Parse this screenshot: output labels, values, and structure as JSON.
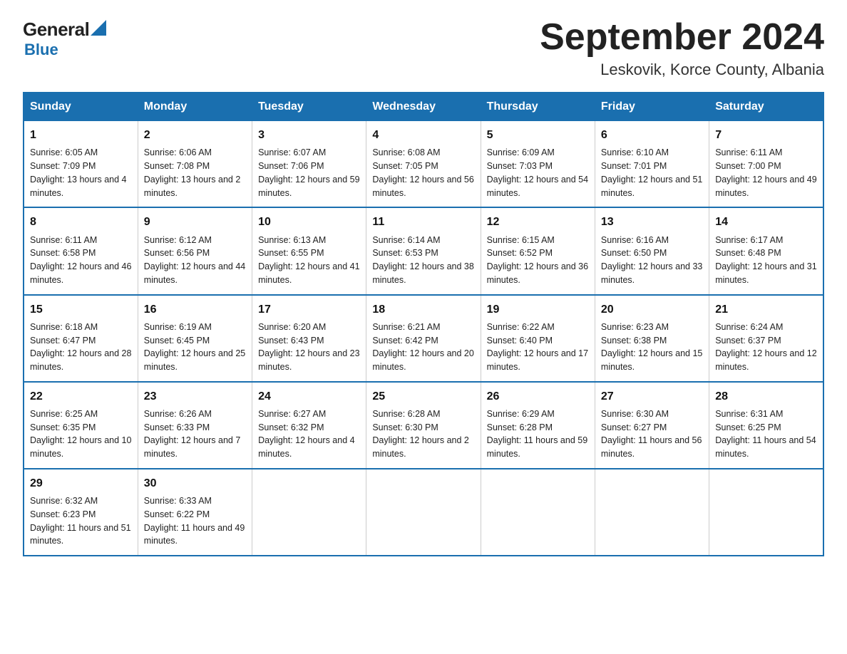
{
  "header": {
    "logo_general": "General",
    "logo_blue": "Blue",
    "title": "September 2024",
    "location": "Leskovik, Korce County, Albania"
  },
  "days_of_week": [
    "Sunday",
    "Monday",
    "Tuesday",
    "Wednesday",
    "Thursday",
    "Friday",
    "Saturday"
  ],
  "weeks": [
    [
      {
        "num": "1",
        "sunrise": "6:05 AM",
        "sunset": "7:09 PM",
        "daylight": "13 hours and 4 minutes."
      },
      {
        "num": "2",
        "sunrise": "6:06 AM",
        "sunset": "7:08 PM",
        "daylight": "13 hours and 2 minutes."
      },
      {
        "num": "3",
        "sunrise": "6:07 AM",
        "sunset": "7:06 PM",
        "daylight": "12 hours and 59 minutes."
      },
      {
        "num": "4",
        "sunrise": "6:08 AM",
        "sunset": "7:05 PM",
        "daylight": "12 hours and 56 minutes."
      },
      {
        "num": "5",
        "sunrise": "6:09 AM",
        "sunset": "7:03 PM",
        "daylight": "12 hours and 54 minutes."
      },
      {
        "num": "6",
        "sunrise": "6:10 AM",
        "sunset": "7:01 PM",
        "daylight": "12 hours and 51 minutes."
      },
      {
        "num": "7",
        "sunrise": "6:11 AM",
        "sunset": "7:00 PM",
        "daylight": "12 hours and 49 minutes."
      }
    ],
    [
      {
        "num": "8",
        "sunrise": "6:11 AM",
        "sunset": "6:58 PM",
        "daylight": "12 hours and 46 minutes."
      },
      {
        "num": "9",
        "sunrise": "6:12 AM",
        "sunset": "6:56 PM",
        "daylight": "12 hours and 44 minutes."
      },
      {
        "num": "10",
        "sunrise": "6:13 AM",
        "sunset": "6:55 PM",
        "daylight": "12 hours and 41 minutes."
      },
      {
        "num": "11",
        "sunrise": "6:14 AM",
        "sunset": "6:53 PM",
        "daylight": "12 hours and 38 minutes."
      },
      {
        "num": "12",
        "sunrise": "6:15 AM",
        "sunset": "6:52 PM",
        "daylight": "12 hours and 36 minutes."
      },
      {
        "num": "13",
        "sunrise": "6:16 AM",
        "sunset": "6:50 PM",
        "daylight": "12 hours and 33 minutes."
      },
      {
        "num": "14",
        "sunrise": "6:17 AM",
        "sunset": "6:48 PM",
        "daylight": "12 hours and 31 minutes."
      }
    ],
    [
      {
        "num": "15",
        "sunrise": "6:18 AM",
        "sunset": "6:47 PM",
        "daylight": "12 hours and 28 minutes."
      },
      {
        "num": "16",
        "sunrise": "6:19 AM",
        "sunset": "6:45 PM",
        "daylight": "12 hours and 25 minutes."
      },
      {
        "num": "17",
        "sunrise": "6:20 AM",
        "sunset": "6:43 PM",
        "daylight": "12 hours and 23 minutes."
      },
      {
        "num": "18",
        "sunrise": "6:21 AM",
        "sunset": "6:42 PM",
        "daylight": "12 hours and 20 minutes."
      },
      {
        "num": "19",
        "sunrise": "6:22 AM",
        "sunset": "6:40 PM",
        "daylight": "12 hours and 17 minutes."
      },
      {
        "num": "20",
        "sunrise": "6:23 AM",
        "sunset": "6:38 PM",
        "daylight": "12 hours and 15 minutes."
      },
      {
        "num": "21",
        "sunrise": "6:24 AM",
        "sunset": "6:37 PM",
        "daylight": "12 hours and 12 minutes."
      }
    ],
    [
      {
        "num": "22",
        "sunrise": "6:25 AM",
        "sunset": "6:35 PM",
        "daylight": "12 hours and 10 minutes."
      },
      {
        "num": "23",
        "sunrise": "6:26 AM",
        "sunset": "6:33 PM",
        "daylight": "12 hours and 7 minutes."
      },
      {
        "num": "24",
        "sunrise": "6:27 AM",
        "sunset": "6:32 PM",
        "daylight": "12 hours and 4 minutes."
      },
      {
        "num": "25",
        "sunrise": "6:28 AM",
        "sunset": "6:30 PM",
        "daylight": "12 hours and 2 minutes."
      },
      {
        "num": "26",
        "sunrise": "6:29 AM",
        "sunset": "6:28 PM",
        "daylight": "11 hours and 59 minutes."
      },
      {
        "num": "27",
        "sunrise": "6:30 AM",
        "sunset": "6:27 PM",
        "daylight": "11 hours and 56 minutes."
      },
      {
        "num": "28",
        "sunrise": "6:31 AM",
        "sunset": "6:25 PM",
        "daylight": "11 hours and 54 minutes."
      }
    ],
    [
      {
        "num": "29",
        "sunrise": "6:32 AM",
        "sunset": "6:23 PM",
        "daylight": "11 hours and 51 minutes."
      },
      {
        "num": "30",
        "sunrise": "6:33 AM",
        "sunset": "6:22 PM",
        "daylight": "11 hours and 49 minutes."
      },
      {
        "num": "",
        "sunrise": "",
        "sunset": "",
        "daylight": ""
      },
      {
        "num": "",
        "sunrise": "",
        "sunset": "",
        "daylight": ""
      },
      {
        "num": "",
        "sunrise": "",
        "sunset": "",
        "daylight": ""
      },
      {
        "num": "",
        "sunrise": "",
        "sunset": "",
        "daylight": ""
      },
      {
        "num": "",
        "sunrise": "",
        "sunset": "",
        "daylight": ""
      }
    ]
  ]
}
